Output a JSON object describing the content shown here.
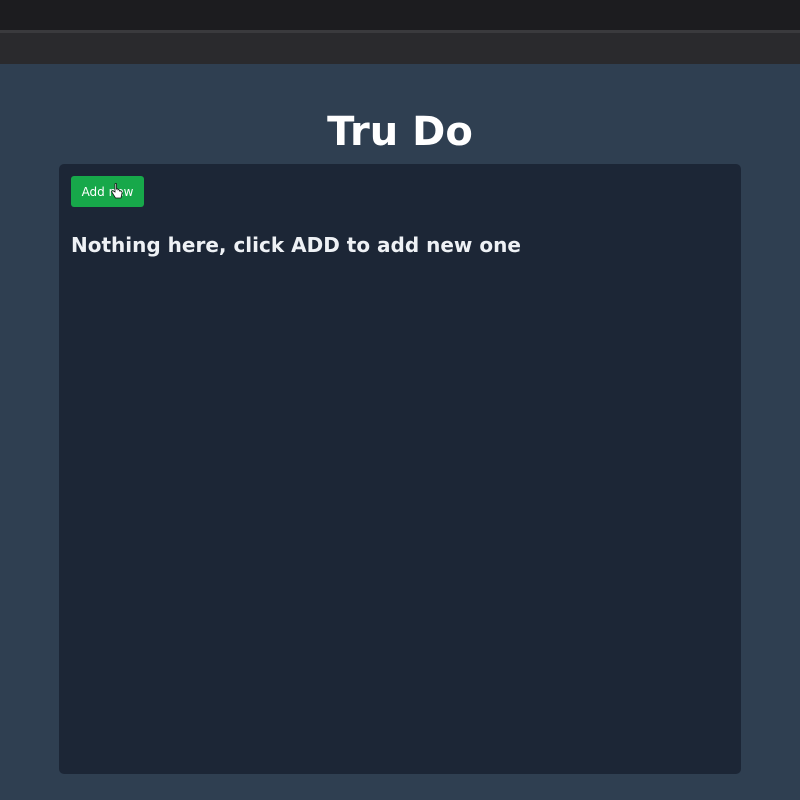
{
  "app": {
    "title": "Tru Do"
  },
  "toolbar": {
    "add_label": "Add new"
  },
  "main": {
    "empty_message": "Nothing here, click ADD to add new one"
  },
  "colors": {
    "background": "#2f3f51",
    "panel": "#1c2636",
    "accent": "#17a84a",
    "text": "#ffffff"
  },
  "icons": {
    "cursor": "hand-pointer-icon"
  }
}
